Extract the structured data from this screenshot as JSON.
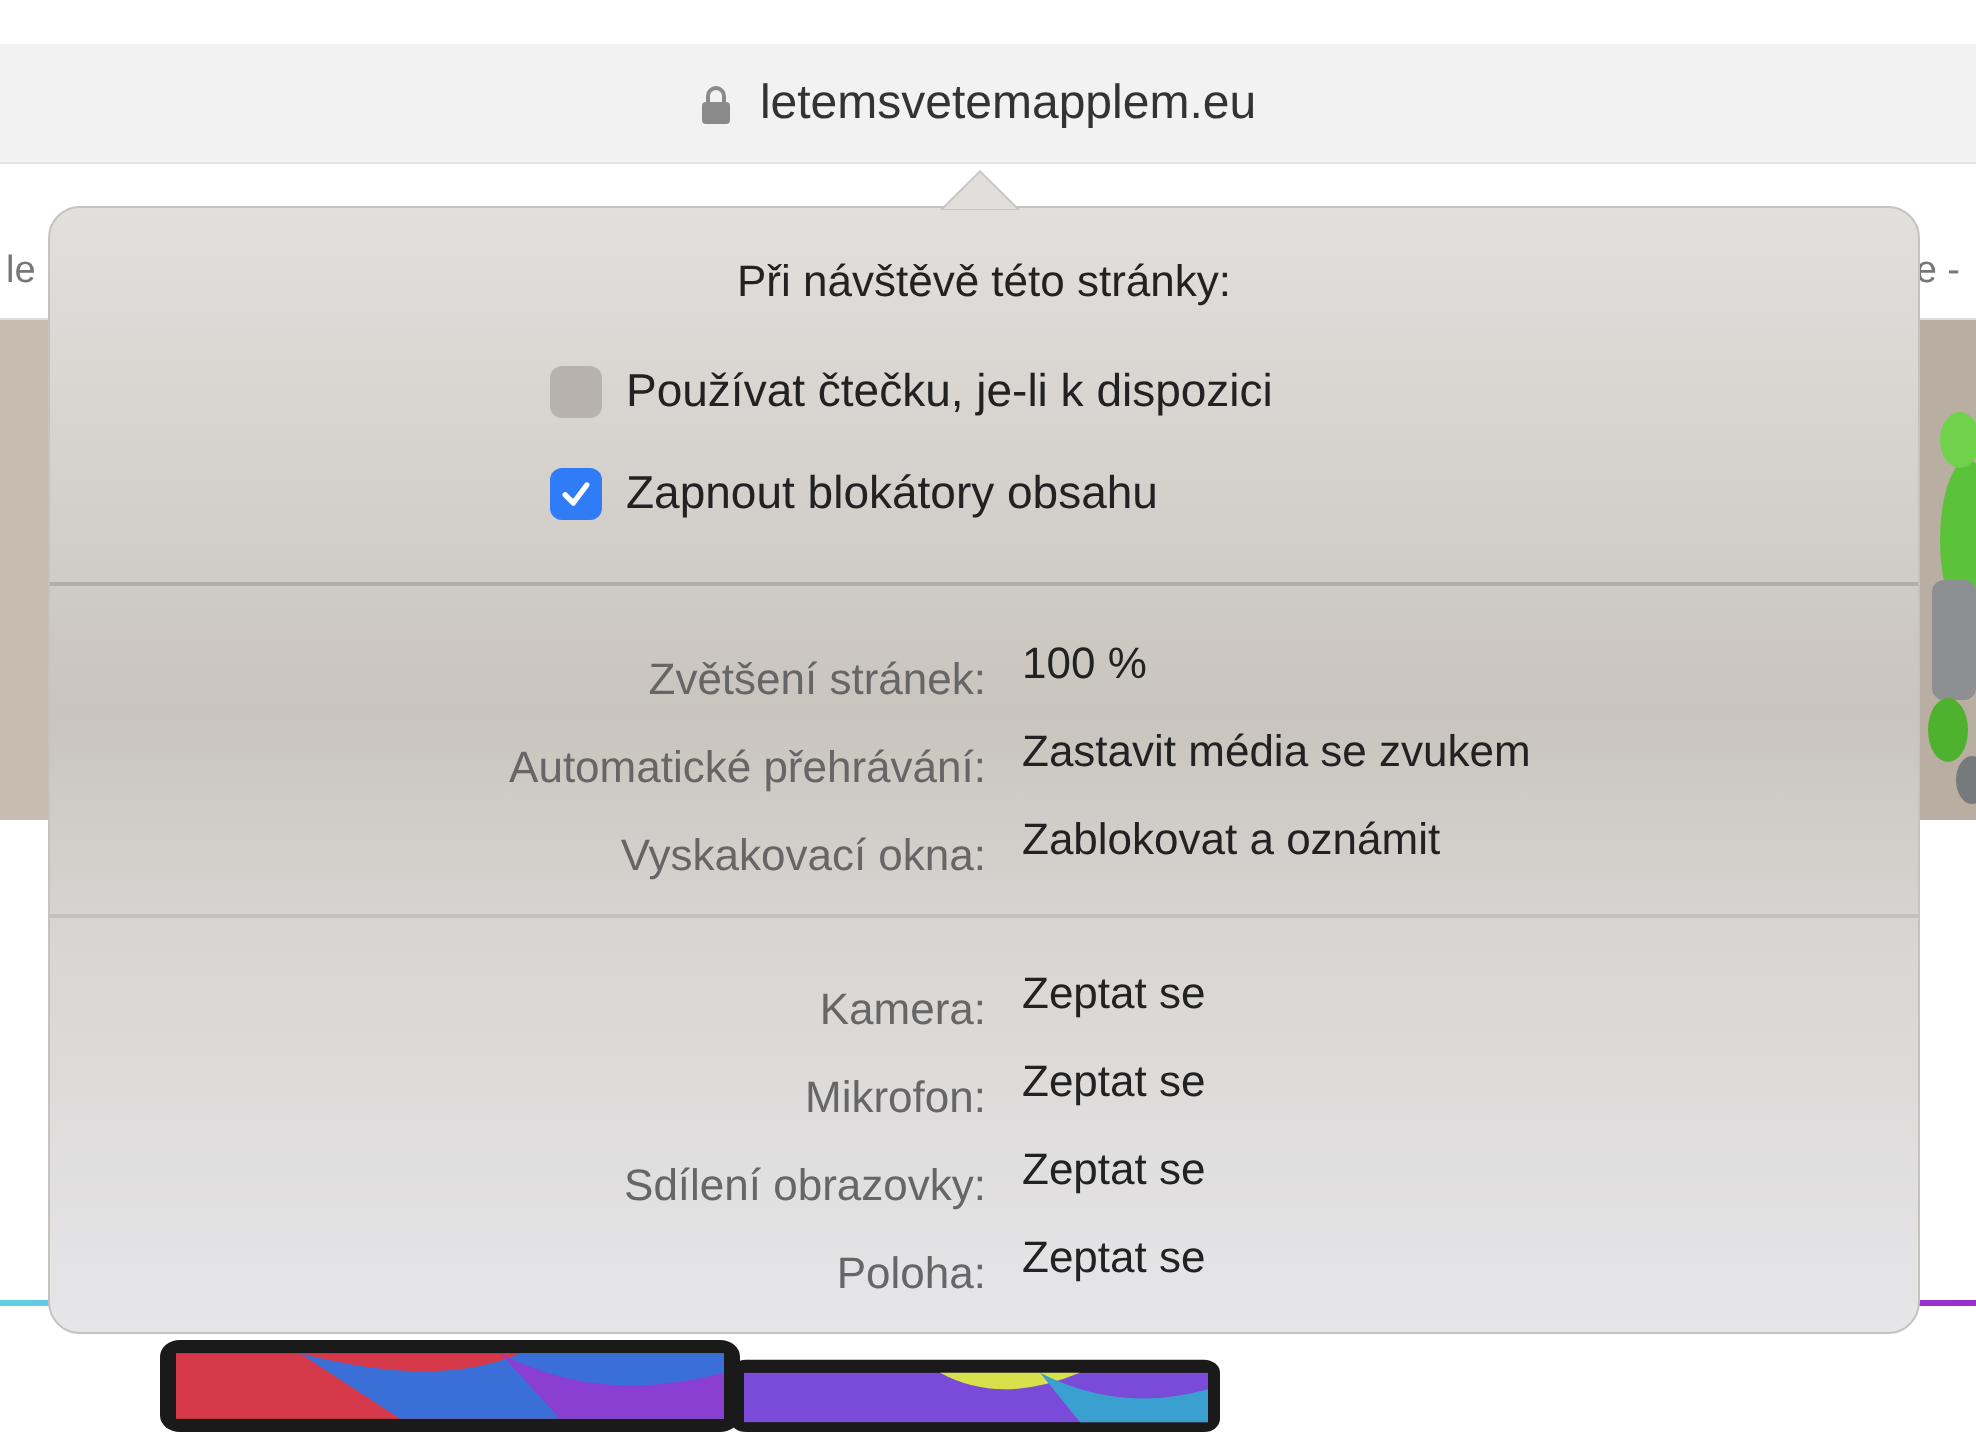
{
  "address_bar": {
    "url": "letemsvetemapplem.eu"
  },
  "page_behind": {
    "tab_left": "le",
    "tab_right": "e -"
  },
  "popover": {
    "title": "Při návštěvě této stránky:",
    "options": [
      {
        "label": "Používat čtečku, je-li k dispozici",
        "checked": false
      },
      {
        "label": "Zapnout blokátory obsahu",
        "checked": true
      }
    ],
    "groups": [
      {
        "rows": [
          {
            "label": "Zvětšení stránek:",
            "value": "100 %"
          },
          {
            "label": "Automatické přehrávání:",
            "value": "Zastavit média se zvukem"
          },
          {
            "label": "Vyskakovací okna:",
            "value": "Zablokovat a oznámit"
          }
        ]
      },
      {
        "rows": [
          {
            "label": "Kamera:",
            "value": "Zeptat se"
          },
          {
            "label": "Mikrofon:",
            "value": "Zeptat se"
          },
          {
            "label": "Sdílení obrazovky:",
            "value": "Zeptat se"
          },
          {
            "label": "Poloha:",
            "value": "Zeptat se"
          }
        ]
      }
    ]
  }
}
